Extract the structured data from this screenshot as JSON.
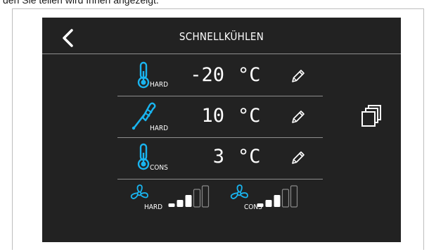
{
  "caption": "den Sie teilen wird Ihnen angezeigt.",
  "header": {
    "title": "SCHNELLKÜHLEN"
  },
  "rows": [
    {
      "icon": "thermometer-icon",
      "sub": "HARD",
      "value": "-20",
      "unit": "°C"
    },
    {
      "icon": "probe-icon",
      "sub": "HARD",
      "value": "10",
      "unit": "°C"
    },
    {
      "icon": "thermometer-icon",
      "sub": "CONS",
      "value": "3",
      "unit": "°C"
    }
  ],
  "fans": [
    {
      "icon": "fan-icon",
      "sub": "HARD",
      "level": 3,
      "max": 5
    },
    {
      "icon": "fan-icon",
      "sub": "CONS",
      "level": 3,
      "max": 5
    }
  ],
  "colors": {
    "accent": "#19b4ef",
    "background": "#222222",
    "text": "#ffffff",
    "separator": "#8e8e8e"
  }
}
